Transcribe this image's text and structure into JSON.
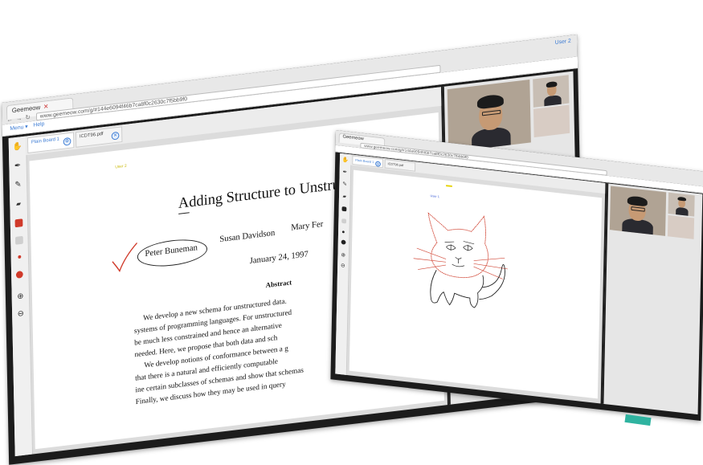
{
  "back_window": {
    "tab_title": "Geemeow",
    "address": "www.geemeow.com/g/#144e6094f46b7ca8f0c2630c7f5bb9f0",
    "user": "User 2",
    "menu": [
      "Menu ▾",
      "Help"
    ],
    "doc_tabs": [
      {
        "label": "Plain Board 1"
      },
      {
        "label": "ICDT96.pdf"
      }
    ],
    "cursor_label": "User 2",
    "paper": {
      "title": "Adding Structure to Unstructured",
      "authors": [
        "Peter Buneman",
        "Susan Davidson",
        "Mary Fer"
      ],
      "date": "January 24, 1997",
      "abstract_heading": "Abstract",
      "abstract_lines": [
        "We develop a new schema for unstructured data.",
        "systems of programming languages. For unstructured",
        "be much less constrained and hence an alternative",
        "needed. Here, we propose that both data and sch",
        "We develop notions of conformance between a g",
        "that there is a natural and efficiently computable",
        "ine certain subclasses of schemas and show that schemas",
        "Finally, we discuss how they may be used in query"
      ]
    }
  },
  "front_window": {
    "tab_title": "Geemeow",
    "address": "www.geemeow.com/g/#144e6094f46b7ca8f0c2630c7f5bb9f0",
    "doc_tabs": [
      {
        "label": "Plain Board 1"
      },
      {
        "label": "ICDT96.pdf"
      }
    ],
    "cursor_label": "User 1"
  },
  "icons": {
    "tools": [
      "hand-icon",
      "pen-icon",
      "pencil-icon",
      "eraser-icon",
      "red-swatch",
      "gray-swatch",
      "red-dot",
      "red-circle",
      "zoom-in-icon",
      "zoom-out-icon"
    ]
  },
  "colors": {
    "accent": "#3b7bd4",
    "annotation_red": "#d03a2a",
    "drawing_red": "#d24a3a",
    "teal": "#2fb3a0"
  }
}
